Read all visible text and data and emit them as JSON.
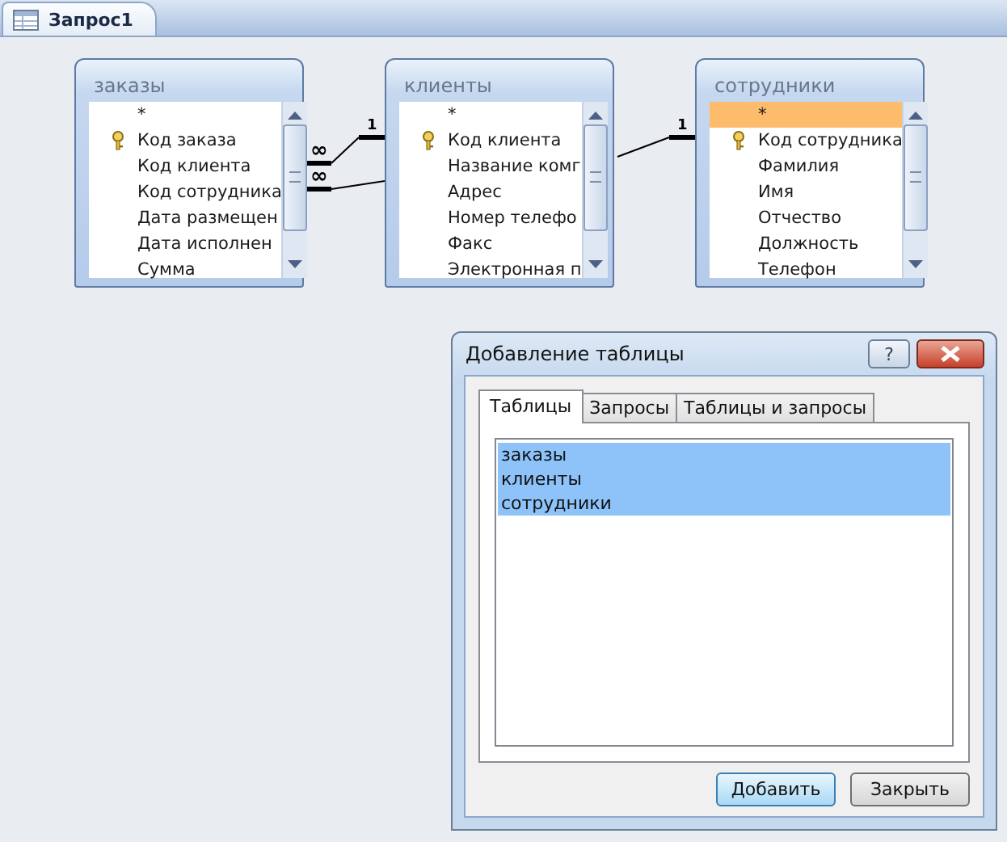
{
  "document_tabs": [
    {
      "label": "Запрос1",
      "selected": true
    }
  ],
  "tables": [
    {
      "name": "заказы",
      "fields": [
        {
          "label": "*",
          "key": false,
          "selected": false
        },
        {
          "label": "Код заказа",
          "key": true,
          "selected": false
        },
        {
          "label": "Код клиента",
          "key": false,
          "selected": false
        },
        {
          "label": "Код сотрудника",
          "key": false,
          "selected": false
        },
        {
          "label": "Дата размещен",
          "key": false,
          "selected": false
        },
        {
          "label": "Дата исполнен",
          "key": false,
          "selected": false
        },
        {
          "label": "Сумма",
          "key": false,
          "selected": false
        }
      ]
    },
    {
      "name": "клиенты",
      "fields": [
        {
          "label": "*",
          "key": false,
          "selected": false
        },
        {
          "label": "Код клиента",
          "key": true,
          "selected": false
        },
        {
          "label": "Название комг",
          "key": false,
          "selected": false
        },
        {
          "label": "Адрес",
          "key": false,
          "selected": false
        },
        {
          "label": "Номер телефо",
          "key": false,
          "selected": false
        },
        {
          "label": "Факс",
          "key": false,
          "selected": false
        },
        {
          "label": "Электронная п",
          "key": false,
          "selected": false
        }
      ]
    },
    {
      "name": "сотрудники",
      "fields": [
        {
          "label": "*",
          "key": false,
          "selected": true
        },
        {
          "label": "Код сотрудника",
          "key": true,
          "selected": false
        },
        {
          "label": "Фамилия",
          "key": false,
          "selected": false
        },
        {
          "label": "Имя",
          "key": false,
          "selected": false
        },
        {
          "label": "Отчество",
          "key": false,
          "selected": false
        },
        {
          "label": "Должность",
          "key": false,
          "selected": false
        },
        {
          "label": "Телефон",
          "key": false,
          "selected": false
        }
      ]
    }
  ],
  "relationships": [
    {
      "many_label": "∞",
      "one_label": "1"
    },
    {
      "many_label": "∞",
      "one_label": "1"
    }
  ],
  "dialog": {
    "title": "Добавление таблицы",
    "help_button": "?",
    "tabs": [
      {
        "label": "Таблицы",
        "selected": true
      },
      {
        "label": "Запросы",
        "selected": false
      },
      {
        "label": "Таблицы и запросы",
        "selected": false
      }
    ],
    "items": [
      {
        "label": "заказы",
        "selected": true
      },
      {
        "label": "клиенты",
        "selected": true
      },
      {
        "label": "сотрудники",
        "selected": true
      }
    ],
    "buttons": [
      {
        "label": "Добавить",
        "default": true
      },
      {
        "label": "Закрыть",
        "default": false
      }
    ]
  }
}
